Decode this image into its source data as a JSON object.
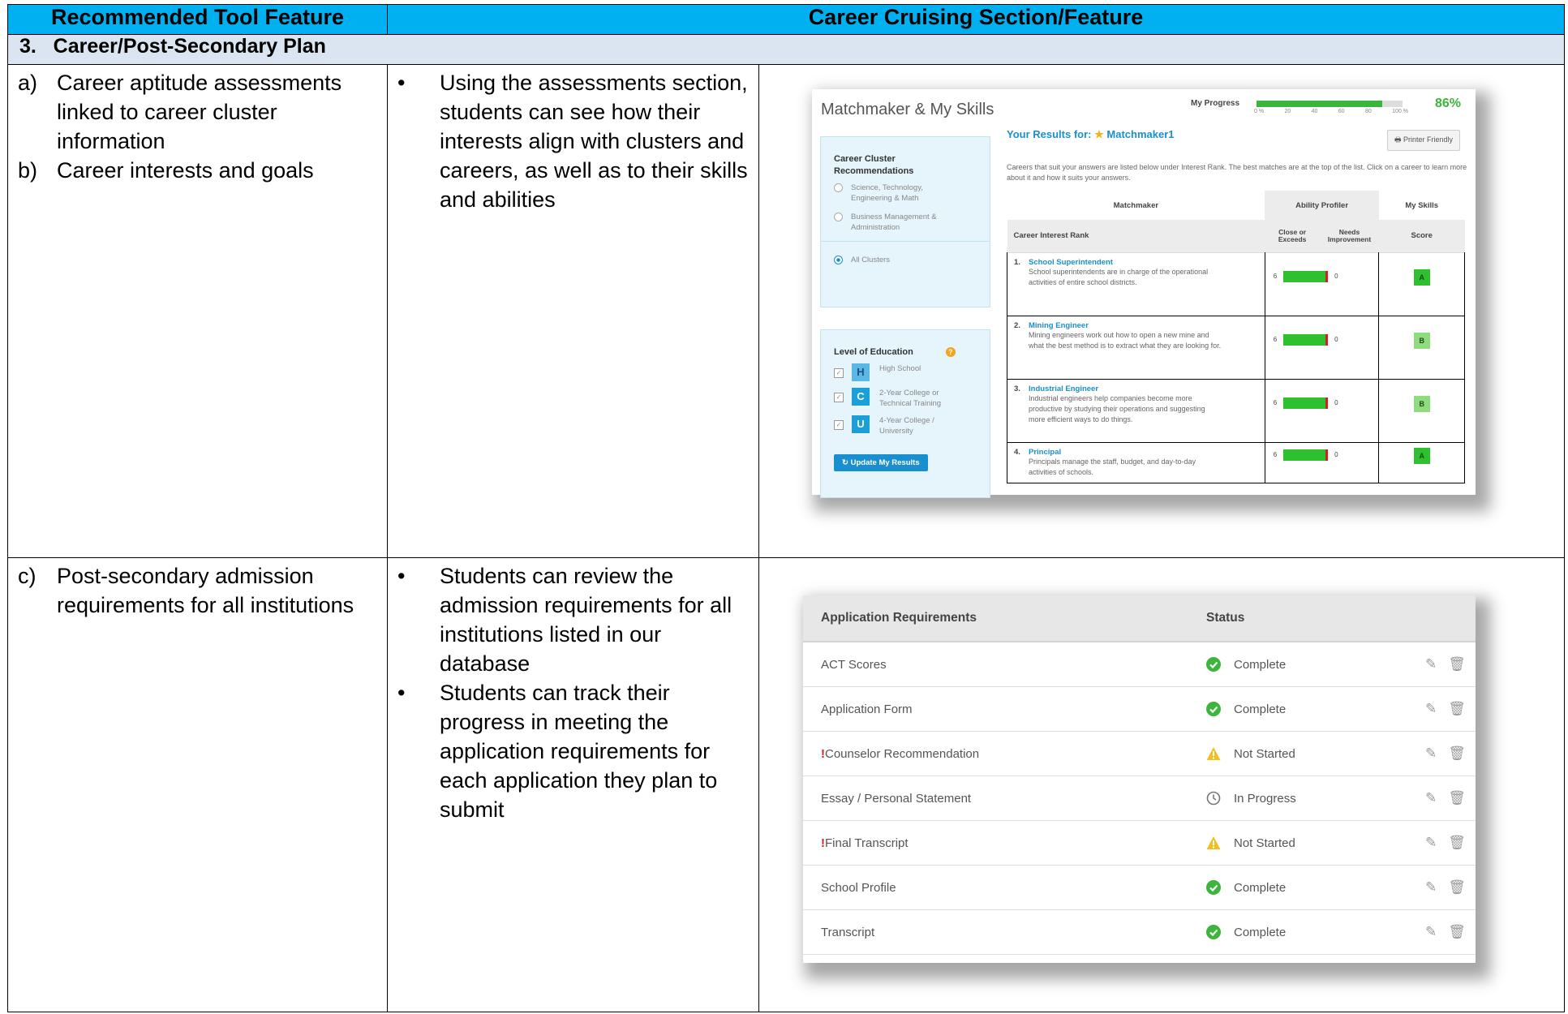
{
  "header": {
    "col1": "Recommended Tool Feature",
    "col2": "Career Cruising Section/Feature"
  },
  "section": {
    "title": "3.   Career/Post-Secondary Plan"
  },
  "row1": {
    "features": [
      {
        "marker": "a)",
        "text": "Career aptitude assessments linked to career cluster information"
      },
      {
        "marker": "b)",
        "text": "Career interests and goals"
      }
    ],
    "bullets": [
      "Using the assessments section, students can see how their interests align with clusters and careers, as well as to their skills and abilities"
    ]
  },
  "row2": {
    "features": [
      {
        "marker": "c)",
        "text": "Post-secondary admission requirements for all institutions"
      }
    ],
    "bullets": [
      "Students can review the admission requirements for all institutions listed in our database",
      "Students can track their progress in meeting the application requirements for each application they plan to submit"
    ]
  },
  "matchmaker": {
    "title": "Matchmaker & My Skills",
    "progress_label": "My Progress",
    "progress_pct": "86%",
    "progress_value": 0.86,
    "progress_ticks": [
      "0 %",
      "20",
      "40",
      "60",
      "80",
      "100 %"
    ],
    "cluster_heading": "Career Cluster Recommendations",
    "cluster_options": [
      "Science, Technology, Engineering & Math",
      "Business Management & Administration"
    ],
    "all_clusters": "All Clusters",
    "edu_heading": "Level of Education",
    "edu_levels": [
      {
        "letter": "H",
        "label": "High School"
      },
      {
        "letter": "C",
        "label": "2-Year College or Technical Training"
      },
      {
        "letter": "U",
        "label": "4-Year College / University"
      }
    ],
    "update_button": "Update My Results",
    "results_label": "Your Results for:",
    "results_name": "Matchmaker1",
    "printer_button": "Printer Friendly",
    "description": "Careers that suit your answers are listed below under Interest Rank. The best matches are at the top of the list. Click on a career to learn more about it and how it suits your answers.",
    "col_matchmaker": "Matchmaker",
    "col_ability": "Ability Profiler",
    "col_skills": "My Skills",
    "col_rank": "Career Interest Rank",
    "col_close": "Close or Exceeds",
    "col_needs": "Needs Improvement",
    "col_score": "Score",
    "careers": [
      {
        "num": "1.",
        "name": "School Superintendent",
        "desc": "School superintendents are in charge of the operational activities of entire school districts.",
        "close": "6",
        "needs": "0",
        "grade": "A"
      },
      {
        "num": "2.",
        "name": "Mining Engineer",
        "desc": "Mining engineers work out how to open a new mine and what the best method is to extract what they are looking for.",
        "close": "6",
        "needs": "0",
        "grade": "B"
      },
      {
        "num": "3.",
        "name": "Industrial Engineer",
        "desc": "Industrial engineers help companies become more productive by studying their operations and suggesting more efficient ways to do things.",
        "close": "6",
        "needs": "0",
        "grade": "B"
      },
      {
        "num": "4.",
        "name": "Principal",
        "desc": "Principals manage the staff, budget, and day-to-day activities of schools.",
        "close": "6",
        "needs": "0",
        "grade": "A"
      }
    ]
  },
  "applications": {
    "col_req": "Application Requirements",
    "col_status": "Status",
    "rows": [
      {
        "flag": "",
        "name": "ACT Scores",
        "status": "Complete",
        "icon": "check-icon"
      },
      {
        "flag": "",
        "name": "Application Form",
        "status": "Complete",
        "icon": "check-icon"
      },
      {
        "flag": "!",
        "name": "Counselor Recommendation",
        "status": "Not Started",
        "icon": "warning-icon"
      },
      {
        "flag": "",
        "name": "Essay / Personal Statement",
        "status": "In Progress",
        "icon": "clock-icon"
      },
      {
        "flag": "!",
        "name": "Final Transcript",
        "status": "Not Started",
        "icon": "warning-icon"
      },
      {
        "flag": "",
        "name": "School Profile",
        "status": "Complete",
        "icon": "check-icon"
      },
      {
        "flag": "",
        "name": "Transcript",
        "status": "Complete",
        "icon": "check-icon"
      }
    ]
  },
  "colors": {
    "header": "#00b0f0",
    "section": "#dbe5f1",
    "accent": "#1a8fd0",
    "complete": "#3bb53b",
    "warning": "#f0c020"
  }
}
